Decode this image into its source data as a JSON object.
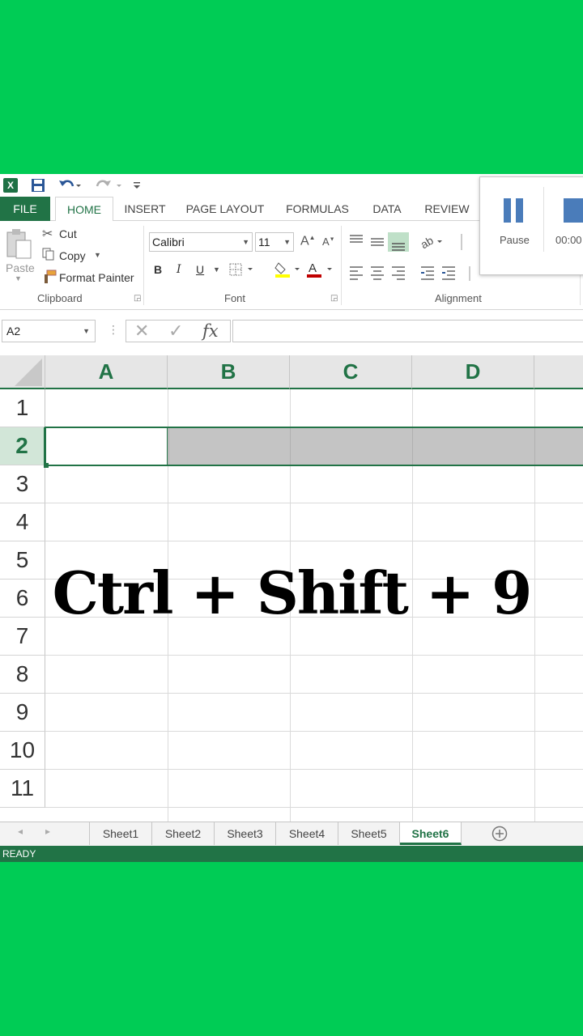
{
  "qat": {
    "app_icon": "excel-logo-icon",
    "save_icon": "save-icon",
    "undo_icon": "undo-icon",
    "redo_icon": "redo-icon",
    "customize_icon": "customize-qat-icon"
  },
  "tabs": [
    "FILE",
    "HOME",
    "INSERT",
    "PAGE LAYOUT",
    "FORMULAS",
    "DATA",
    "REVIEW"
  ],
  "active_tab": "HOME",
  "ribbon": {
    "clipboard": {
      "paste_label": "Paste",
      "cut_label": "Cut",
      "copy_label": "Copy",
      "format_painter_label": "Format Painter",
      "group_label": "Clipboard"
    },
    "font": {
      "font_name": "Calibri",
      "font_size": "11",
      "bold": "B",
      "italic": "I",
      "underline": "U",
      "group_label": "Font"
    },
    "alignment": {
      "group_label": "Alignment"
    }
  },
  "recorder": {
    "pause_label": "Pause",
    "time": "00:00"
  },
  "formula_bar": {
    "name_box": "A2",
    "fx_label": "fx",
    "cancel_glyph": "✕",
    "enter_glyph": "✓",
    "formula": ""
  },
  "grid": {
    "columns": [
      "A",
      "B",
      "C",
      "D"
    ],
    "rows": [
      "1",
      "2",
      "3",
      "4",
      "5",
      "6",
      "7",
      "8",
      "9",
      "10",
      "11"
    ],
    "selected_row": "2",
    "active_cell": "A2"
  },
  "sheet_tabs": [
    "Sheet1",
    "Sheet2",
    "Sheet3",
    "Sheet4",
    "Sheet5",
    "Sheet6"
  ],
  "active_sheet": "Sheet6",
  "status": "READY",
  "caption": "Ctrl + Shift + 9",
  "colors": {
    "background": "#00cc55",
    "excel_green": "#217346",
    "selection_gray": "#c4c4c4"
  }
}
